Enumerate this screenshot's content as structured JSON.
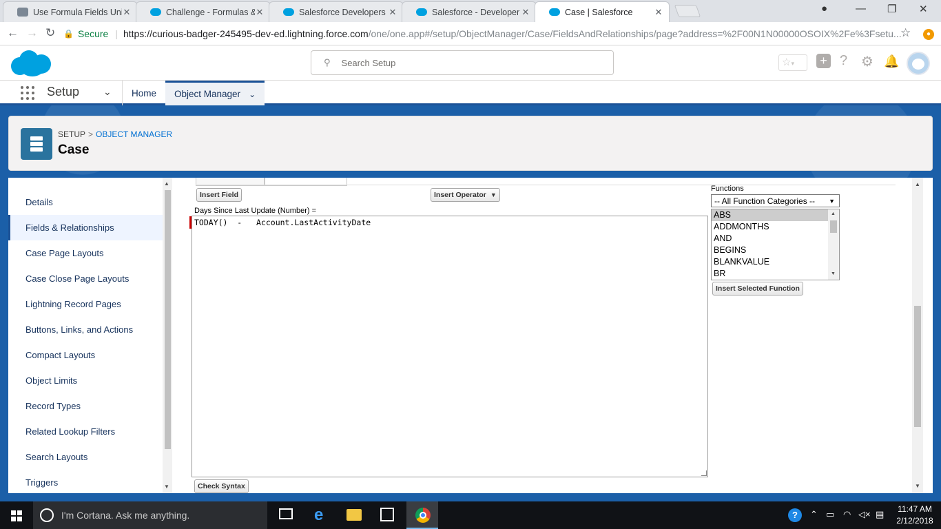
{
  "browser": {
    "tabs": [
      {
        "label": "Use Formula Fields Unit |",
        "icon": "trailhead-icon"
      },
      {
        "label": "Challenge - Formulas & V",
        "icon": "salesforce-cloud-icon"
      },
      {
        "label": "Salesforce Developers | H",
        "icon": "salesforce-cloud-icon"
      },
      {
        "label": "Salesforce - Developer Ed",
        "icon": "salesforce-cloud-icon"
      },
      {
        "label": "Case | Salesforce",
        "icon": "salesforce-cloud-icon"
      }
    ],
    "secure_label": "Secure",
    "url_host": "https://curious-badger-245495-dev-ed.lightning.force.com",
    "url_path": "/one/one.app#/setup/ObjectManager/Case/FieldsAndRelationships/page?address=%2F00N1N00000OSOIX%2Fe%3Fsetu..."
  },
  "header": {
    "search_placeholder": "Search Setup"
  },
  "nav": {
    "app_name": "Setup",
    "tabs": [
      "Home",
      "Object Manager"
    ]
  },
  "page": {
    "crumb_root": "SETUP",
    "crumb_sep": ">",
    "crumb_link": "OBJECT MANAGER",
    "title": "Case"
  },
  "sidebar": {
    "items": [
      "Details",
      "Fields & Relationships",
      "Case Page Layouts",
      "Case Close Page Layouts",
      "Lightning Record Pages",
      "Buttons, Links, and Actions",
      "Compact Layouts",
      "Object Limits",
      "Record Types",
      "Related Lookup Filters",
      "Search Layouts",
      "Triggers"
    ],
    "active_index": 1
  },
  "editor": {
    "insert_field": "Insert Field",
    "insert_operator": "Insert Operator",
    "field_label": "Days Since Last Update (Number) =",
    "formula": "TODAY()  -   Account.LastActivityDate",
    "check_syntax": "Check Syntax",
    "functions_label": "Functions",
    "function_category": "-- All Function Categories --",
    "functions": [
      "ABS",
      "ADDMONTHS",
      "AND",
      "BEGINS",
      "BLANKVALUE",
      "BR"
    ],
    "insert_selected_function": "Insert Selected Function"
  },
  "taskbar": {
    "cortana_placeholder": "I'm Cortana. Ask me anything.",
    "time": "11:47 AM",
    "date": "2/12/2018"
  },
  "colors": {
    "brand_blue": "#1b5297",
    "salesforce_cloud": "#00a1e0",
    "link": "#0070d2"
  }
}
